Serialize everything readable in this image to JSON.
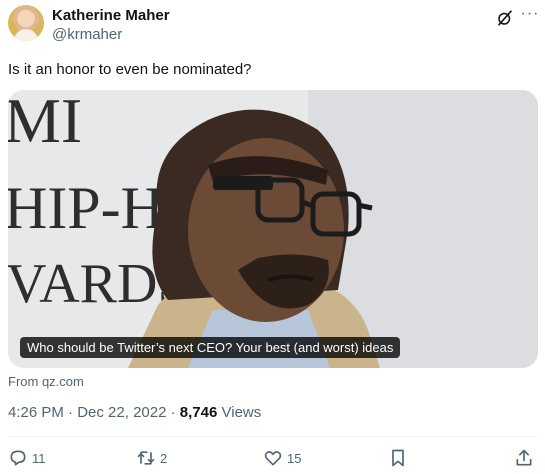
{
  "author": {
    "name": "Katherine Maher",
    "handle": "@krmaher"
  },
  "tweet": {
    "text": "Is it an honor to even be nominated?"
  },
  "card": {
    "caption": "Who should be Twitter’s next CEO? Your best (and worst) ideas",
    "backdrop_text": [
      "MI",
      "HIP-H",
      "VARDS"
    ],
    "source": "From qz.com"
  },
  "meta": {
    "time": "4:26 PM",
    "separator": "·",
    "date": "Dec 22, 2022",
    "views_count": "8,746",
    "views_label": "Views"
  },
  "actions": {
    "replies": "11",
    "retweets": "2",
    "likes": "15"
  },
  "icons": {
    "header_right": [
      "grok-icon",
      "more-icon"
    ],
    "actions": [
      "reply-icon",
      "retweet-icon",
      "like-icon",
      "bookmark-icon",
      "share-icon"
    ]
  },
  "colors": {
    "text_primary": "#0f1419",
    "text_secondary": "#536471",
    "caption_bg": "#000000"
  }
}
